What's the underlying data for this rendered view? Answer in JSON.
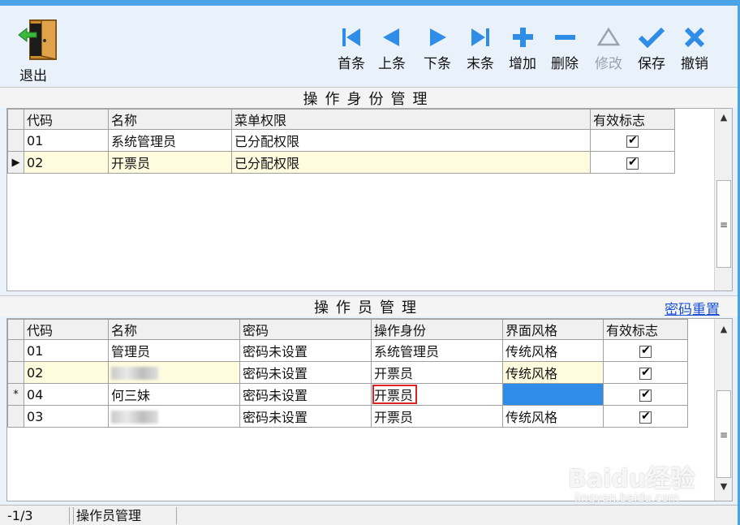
{
  "toolbar": {
    "exit": "退出",
    "buttons": [
      {
        "label": "首条",
        "icon": "first-icon"
      },
      {
        "label": "上条",
        "icon": "prev-icon"
      },
      {
        "label": "下条",
        "icon": "next-icon"
      },
      {
        "label": "末条",
        "icon": "last-icon"
      },
      {
        "label": "增加",
        "icon": "add-icon"
      },
      {
        "label": "删除",
        "icon": "delete-icon"
      },
      {
        "label": "修改",
        "icon": "edit-icon"
      },
      {
        "label": "保存",
        "icon": "save-icon"
      },
      {
        "label": "撤销",
        "icon": "cancel-icon"
      }
    ]
  },
  "identity_section": {
    "title": "操作身份管理",
    "headers": [
      "代码",
      "名称",
      "菜单权限",
      "有效标志"
    ],
    "rows": [
      {
        "code": "01",
        "name": "系统管理员",
        "perm": "已分配权限",
        "valid": true
      },
      {
        "code": "02",
        "name": "开票员",
        "perm": "已分配权限",
        "valid": true
      }
    ]
  },
  "operator_section": {
    "title": "操作员管理",
    "reset_link": "密码重置",
    "headers": [
      "代码",
      "名称",
      "密码",
      "操作身份",
      "界面风格",
      "有效标志"
    ],
    "rows": [
      {
        "marker": "",
        "code": "01",
        "name": "管理员",
        "pwd": "密码未设置",
        "role": "系统管理员",
        "style": "传统风格",
        "valid": true
      },
      {
        "marker": "",
        "code": "02",
        "name": "",
        "pwd": "密码未设置",
        "role": "开票员",
        "style": "传统风格",
        "valid": true
      },
      {
        "marker": "*",
        "code": "04",
        "name": "何三妹",
        "pwd": "密码未设置",
        "role": "开票员",
        "style": "",
        "valid": true
      },
      {
        "marker": "",
        "code": "03",
        "name": "",
        "pwd": "密码未设置",
        "role": "开票员",
        "style": "传统风格",
        "valid": true
      }
    ]
  },
  "status": {
    "position": "-1/3",
    "module": "操作员管理"
  },
  "watermark": {
    "brand": "Baidu经验",
    "url": "jingyan.baidu.com"
  },
  "colors": {
    "accent": "#4aa3e6",
    "icon_blue": "#2f8de8",
    "selected_row": "#fffbdf",
    "highlight_box": "#dd2222",
    "link": "#1a4fd6"
  }
}
